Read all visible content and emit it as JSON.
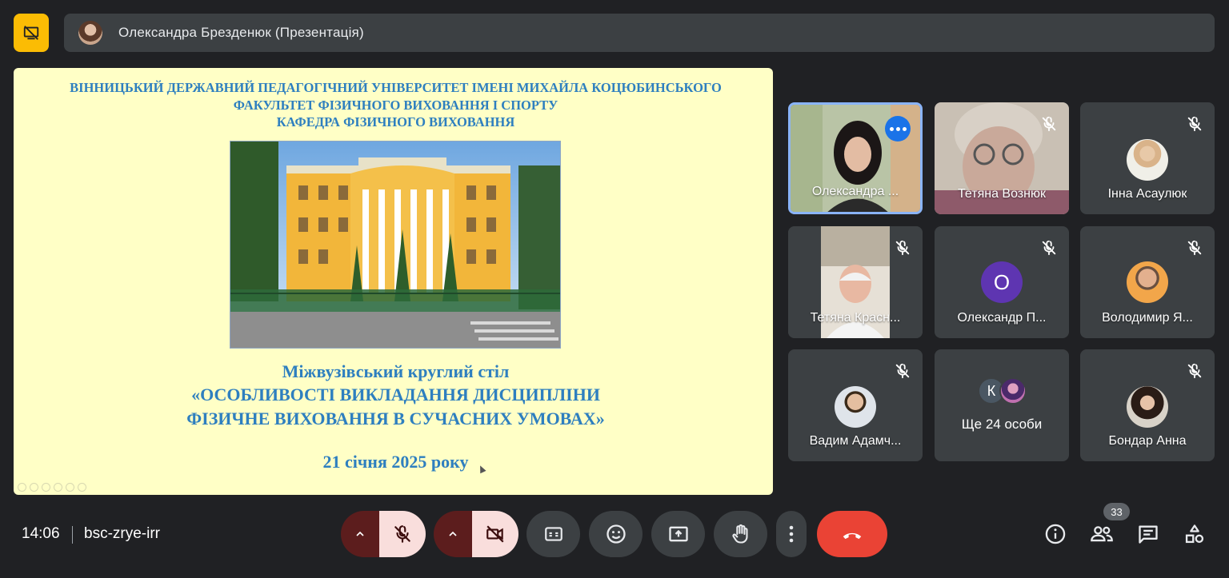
{
  "top_bar": {
    "presenter_title": "Олександра Брезденюк (Презентація)",
    "present_toggle_icon": "present-off-icon"
  },
  "slide": {
    "header_lines": [
      "ВІННИЦЬКИЙ ДЕРЖАВНИЙ ПЕДАГОГІЧНИЙ УНІВЕРСИТЕТ ІМЕНІ МИХАЙЛА КОЦЮБИНСЬКОГО",
      "ФАКУЛЬТЕТ ФІЗИЧНОГО ВИХОВАННЯ І СПОРТУ",
      "КАФЕДРА ФІЗИЧНОГО ВИХОВАННЯ"
    ],
    "title_line1": "Міжвузівський круглий стіл",
    "title_line2": "«ОСОБЛИВОСТІ ВИКЛАДАННЯ ДИСЦИПЛІНИ",
    "title_line3": "ФІЗИЧНЕ ВИХОВАННЯ В СУЧАСНИХ УМОВАХ»",
    "date": "21 січня 2025 року",
    "text_color": "#2e7fbf",
    "background": "#ffffc6"
  },
  "participants": [
    {
      "name": "Олександра ...",
      "muted": false,
      "active_speaker": true
    },
    {
      "name": "Тетяна Вознюк",
      "muted": true
    },
    {
      "name": "Інна Асаулюк",
      "muted": true
    },
    {
      "name": "Тетяна Красн...",
      "muted": true
    },
    {
      "name": "Олександр П...",
      "muted": true,
      "initial": "О"
    },
    {
      "name": "Володимир Я...",
      "muted": true
    },
    {
      "name": "Вадим Адамч...",
      "muted": true
    },
    {
      "name": "Ще 24 особи",
      "initial": "К"
    },
    {
      "name": "Бондар Анна",
      "muted": true
    }
  ],
  "bottom_bar": {
    "time": "14:06",
    "meeting_code": "bsc-zrye-irr",
    "people_count": "33",
    "controls": [
      "mic-options-icon",
      "mic-off-icon",
      "camera-options-icon",
      "camera-off-icon",
      "captions-icon",
      "emoji-icon",
      "present-screen-icon",
      "raise-hand-icon",
      "more-options-icon",
      "end-call-icon"
    ],
    "right_icons": [
      "info-icon",
      "people-icon",
      "chat-icon",
      "activities-icon"
    ],
    "accent_colors": {
      "end_call": "#ea4335",
      "mic_off_bg": "#f9dedc",
      "active_border": "#8ab4f8",
      "present_toggle": "#fbbc04"
    }
  }
}
